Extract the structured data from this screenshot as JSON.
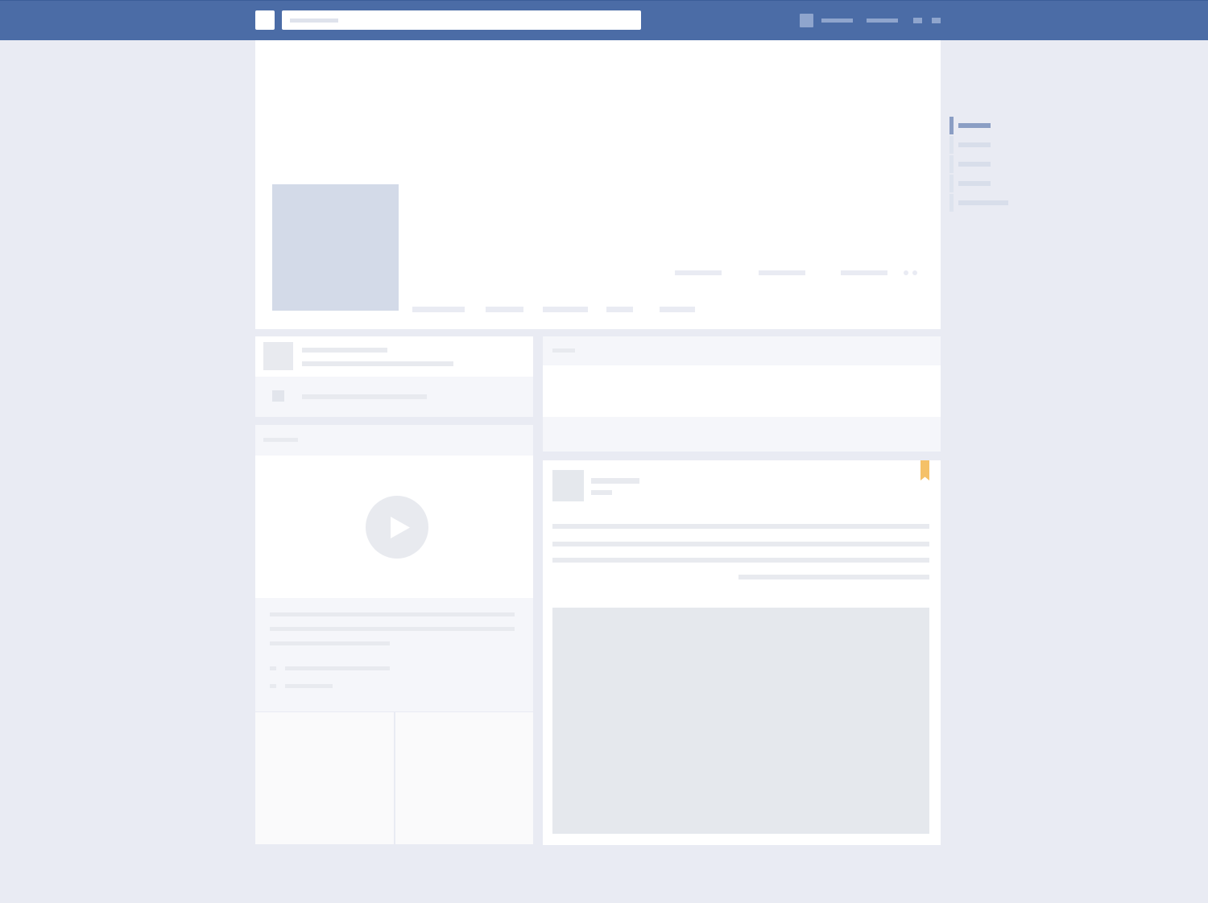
{
  "app": {
    "title": "",
    "colors": {
      "topbar": "#4b6ca6",
      "background": "#e9ebf3",
      "card": "#ffffff",
      "placeholder": "#e8eaef",
      "accent_bookmark": "#f5c168",
      "scrubber_active": "#8b9ec4"
    }
  },
  "topbar": {
    "search": {
      "placeholder": ""
    },
    "nav_items": [
      "",
      ""
    ],
    "icons": [
      "friends-icon",
      "notifications-icon"
    ]
  },
  "cover": {
    "stats_tabs": [
      "",
      "",
      ""
    ],
    "nav_tabs": [
      "",
      "",
      "",
      "",
      ""
    ]
  },
  "scrubber": {
    "items": [
      "",
      "",
      "",
      "",
      ""
    ],
    "active_index": 0
  },
  "left": {
    "intro": {
      "title": "",
      "subtitle": "",
      "item": ""
    },
    "video_card": {
      "header": "",
      "play_icon": "play-icon"
    }
  },
  "right": {
    "composer": {
      "header": ""
    },
    "post": {
      "author": "",
      "time": ""
    }
  }
}
